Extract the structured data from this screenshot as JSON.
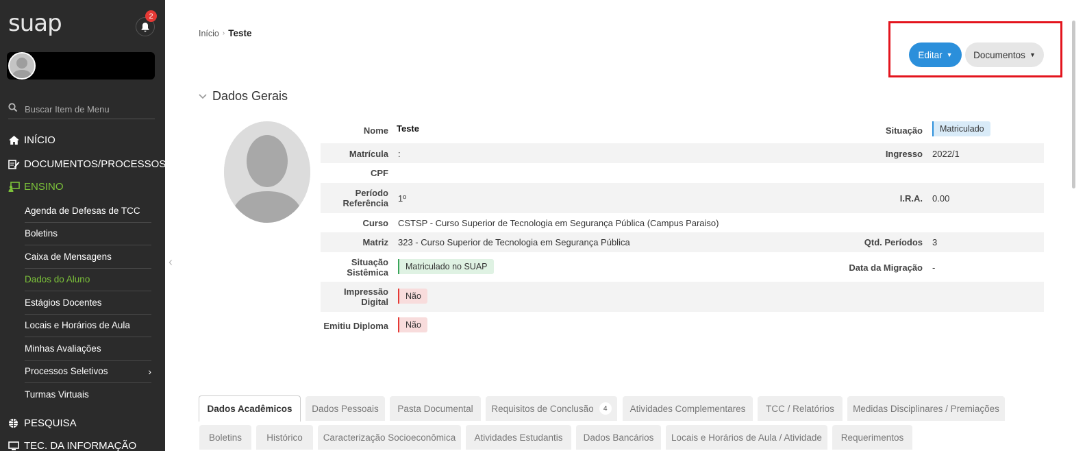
{
  "sidebar": {
    "logo": "suap",
    "notifications_count": "2",
    "search_placeholder": "Buscar Item de Menu",
    "menu": [
      {
        "label": "INÍCIO",
        "icon": "home-icon"
      },
      {
        "label": "DOCUMENTOS/PROCESSOS",
        "icon": "document-edit-icon"
      },
      {
        "label": "ENSINO",
        "icon": "teaching-icon",
        "active": true
      },
      {
        "label": "PESQUISA",
        "icon": "globe-icon"
      },
      {
        "label": "TEC. DA INFORMAÇÃO",
        "icon": "computer-icon"
      }
    ],
    "submenu": [
      {
        "label": "Agenda de Defesas de TCC"
      },
      {
        "label": "Boletins"
      },
      {
        "label": "Caixa de Mensagens"
      },
      {
        "label": "Dados do Aluno",
        "active": true
      },
      {
        "label": "Estágios Docentes"
      },
      {
        "label": "Locais e Horários de Aula"
      },
      {
        "label": "Minhas Avaliações"
      },
      {
        "label": "Processos Seletivos",
        "has_children": true
      },
      {
        "label": "Turmas Virtuais"
      }
    ]
  },
  "breadcrumb": {
    "home": "Início",
    "current": "Teste"
  },
  "actions": {
    "edit": "Editar",
    "documents": "Documentos"
  },
  "section": {
    "title": "Dados Gerais"
  },
  "fields": {
    "nome": {
      "label": "Nome",
      "value": "Teste"
    },
    "situacao": {
      "label": "Situação",
      "value": "Matriculado"
    },
    "matricula": {
      "label": "Matrícula",
      "value": ":"
    },
    "ingresso": {
      "label": "Ingresso",
      "value": "2022/1"
    },
    "cpf": {
      "label": "CPF",
      "value": ""
    },
    "periodo_line1": "Período",
    "periodo_line2": "Referência",
    "periodo_value": "1º",
    "ira": {
      "label": "I.R.A.",
      "value": "0.00"
    },
    "curso": {
      "label": "Curso",
      "value": "CSTSP - Curso Superior de Tecnologia em Segurança Pública (Campus Paraiso)"
    },
    "matriz": {
      "label": "Matriz",
      "value": "323 - Curso Superior de Tecnologia em Segurança Pública"
    },
    "qtd_periodos": {
      "label": "Qtd. Períodos",
      "value": "3"
    },
    "sit_sistemica_line1": "Situação",
    "sit_sistemica_line2": "Sistêmica",
    "sit_sistemica_value": "Matriculado no SUAP",
    "data_migracao": {
      "label": "Data da Migração",
      "value": "-"
    },
    "impressao_line1": "Impressão",
    "impressao_line2": "Digital",
    "impressao_value": "Não",
    "emitiu_diploma": {
      "label": "Emitiu Diploma",
      "value": "Não"
    }
  },
  "tabs_row1": [
    {
      "label": "Dados Acadêmicos",
      "active": true
    },
    {
      "label": "Dados Pessoais"
    },
    {
      "label": "Pasta Documental"
    },
    {
      "label": "Requisitos de Conclusão",
      "count": "4"
    },
    {
      "label": "Atividades Complementares"
    },
    {
      "label": "TCC / Relatórios"
    },
    {
      "label": "Medidas Disciplinares / Premiações"
    }
  ],
  "tabs_row2": [
    {
      "label": "Boletins"
    },
    {
      "label": "Histórico"
    },
    {
      "label": "Caracterização Socioeconômica"
    },
    {
      "label": "Atividades Estudantis"
    },
    {
      "label": "Dados Bancários"
    },
    {
      "label": "Locais e Horários de Aula / Atividade"
    },
    {
      "label": "Requerimentos"
    }
  ],
  "colors": {
    "accent": "#2b8fdb",
    "active_menu": "#7cc23a",
    "highlight_box": "#e3141d"
  }
}
